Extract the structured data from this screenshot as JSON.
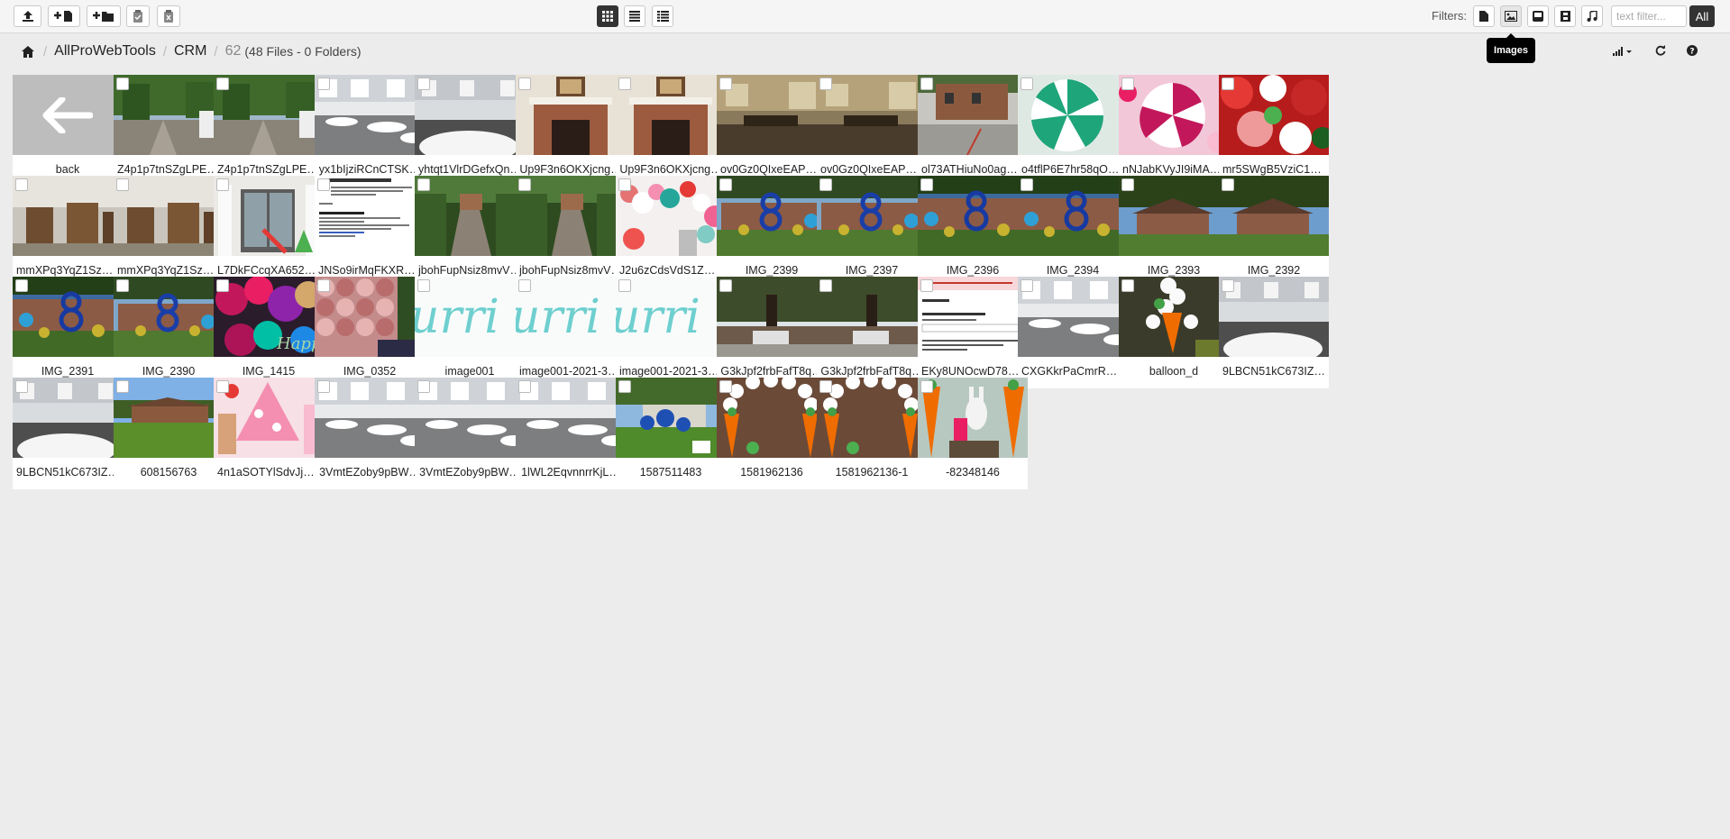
{
  "toolbar": {
    "upload_icon": "upload-icon",
    "new_file_icon": "new-file-icon",
    "new_folder_icon": "new-folder-icon",
    "paste_icon": "clipboard-paste-icon",
    "clear_clipboard_icon": "clipboard-clear-icon",
    "view_modes": [
      "grid",
      "list",
      "columns"
    ],
    "active_view": "grid"
  },
  "filters": {
    "label": "Filters:",
    "types": [
      "document",
      "images",
      "archive",
      "video",
      "audio"
    ],
    "text_placeholder": "text filter...",
    "all_label": "All",
    "tooltip": "Images"
  },
  "breadcrumb": {
    "root": "AllProWebTools",
    "folder": "CRM",
    "count": "62",
    "meta": "(48 Files - 0 Folders)"
  },
  "right_controls": [
    "sort-icon",
    "refresh-icon",
    "help-icon"
  ],
  "back_label": "back",
  "files": [
    {
      "name": "Z4p1p7tnSZgLPEJ…",
      "theme": "garden"
    },
    {
      "name": "Z4p1p7tnSZgLPEJ…",
      "theme": "garden"
    },
    {
      "name": "yx1bIjziRCnCTSK…",
      "theme": "hall"
    },
    {
      "name": "yhtqt1VlrDGefxQn…",
      "theme": "hall2"
    },
    {
      "name": "Up9F3n6OKXjcng…",
      "theme": "fireplace"
    },
    {
      "name": "Up9F3n6OKXjcng…",
      "theme": "fireplace"
    },
    {
      "name": "ov0Gz0QIxeEAPO…",
      "theme": "room"
    },
    {
      "name": "ov0Gz0QIxeEAPO…",
      "theme": "room"
    },
    {
      "name": "ol73ATHiuNo0agD…",
      "theme": "building"
    },
    {
      "name": "o4tflP6E7hr58qO4…",
      "theme": "candy-green"
    },
    {
      "name": "nNJabKVyJI9iMAv…",
      "theme": "candy-pink"
    },
    {
      "name": "mr5SWgB5VziC19…",
      "theme": "candy-red"
    },
    {
      "name": "mmXPq3YqZ1Szw…",
      "theme": "chairs"
    },
    {
      "name": "mmXPq3YqZ1Szw…",
      "theme": "chairs"
    },
    {
      "name": "L7DkFCcqXA652g…",
      "theme": "doors"
    },
    {
      "name": "JNSo9irMqFKXRA…",
      "theme": "document"
    },
    {
      "name": "jbohFupNsiz8mvV…",
      "theme": "path"
    },
    {
      "name": "jbohFupNsiz8mvV…",
      "theme": "path"
    },
    {
      "name": "J2u6zCdsVdS1ZU…",
      "theme": "balloons"
    },
    {
      "name": "IMG_2399",
      "theme": "house8"
    },
    {
      "name": "IMG_2397",
      "theme": "house8"
    },
    {
      "name": "IMG_2396",
      "theme": "house8b"
    },
    {
      "name": "IMG_2394",
      "theme": "house8b"
    },
    {
      "name": "IMG_2393",
      "theme": "house-tree"
    },
    {
      "name": "IMG_2392",
      "theme": "house-tree"
    },
    {
      "name": "IMG_2391",
      "theme": "house8b"
    },
    {
      "name": "IMG_2390",
      "theme": "house8"
    },
    {
      "name": "IMG_1415",
      "theme": "balloon-happy"
    },
    {
      "name": "IMG_0352",
      "theme": "balloon-wall"
    },
    {
      "name": "image001",
      "theme": "logo"
    },
    {
      "name": "image001-2021-34…",
      "theme": "logo"
    },
    {
      "name": "image001-2021-30…",
      "theme": "logo"
    },
    {
      "name": "G3kJpf2frbFafT8q…",
      "theme": "big-tree"
    },
    {
      "name": "G3kJpf2frbFafT8q…",
      "theme": "big-tree"
    },
    {
      "name": "EKy8UNOcwD78o…",
      "theme": "form"
    },
    {
      "name": "CXGKkrPaCmrRU…",
      "theme": "hall"
    },
    {
      "name": "balloon_d",
      "theme": "carrot"
    },
    {
      "name": "9LBCN51kC673IZ…",
      "theme": "hall2"
    },
    {
      "name": "9LBCN51kC673IZ…",
      "theme": "hall2"
    },
    {
      "name": "608156763",
      "theme": "lawn"
    },
    {
      "name": "4n1aSOTYlSdvJjB…",
      "theme": "pink-tree"
    },
    {
      "name": "3VmtEZoby9pBW…",
      "theme": "hall"
    },
    {
      "name": "3VmtEZoby9pBW…",
      "theme": "hall"
    },
    {
      "name": "1lWL2EqvnnrrKjL…",
      "theme": "hall"
    },
    {
      "name": "1587511483",
      "theme": "yard-sign"
    },
    {
      "name": "1581962136",
      "theme": "arch"
    },
    {
      "name": "1581962136-1",
      "theme": "arch"
    },
    {
      "name": "-82348146",
      "theme": "bunny"
    }
  ],
  "colors": {
    "background": "#ececec",
    "toolbar": "#f5f5f5",
    "active_button": "#333333"
  }
}
